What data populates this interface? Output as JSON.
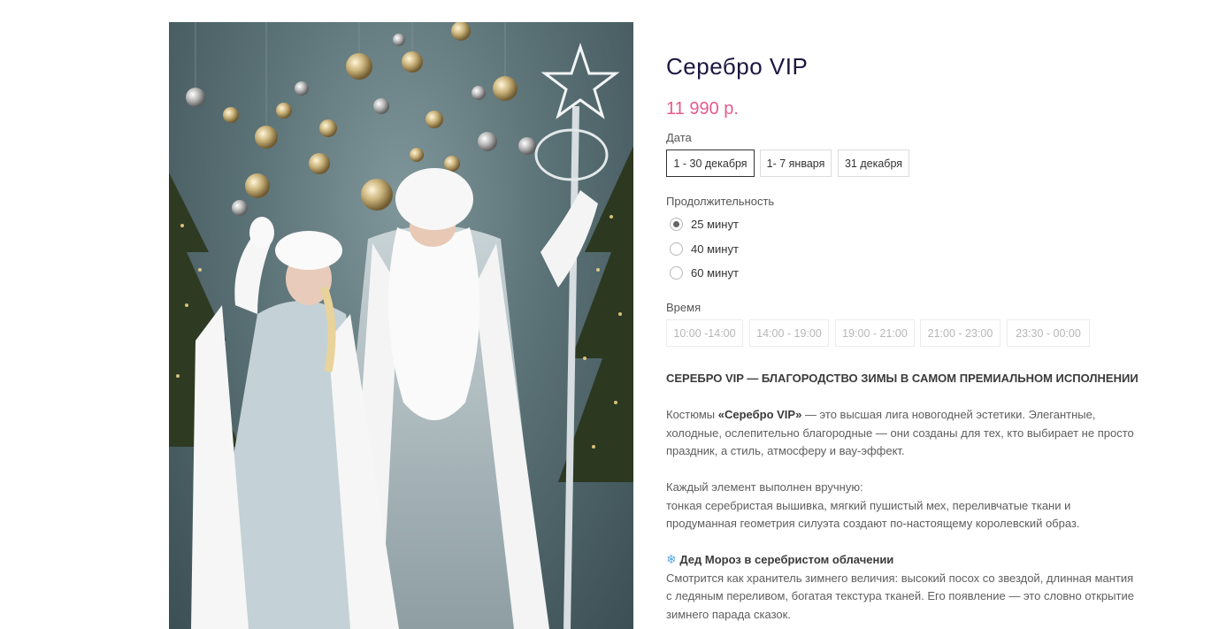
{
  "product": {
    "title": "Серебро VIP",
    "price": "11 990 р.",
    "image_alt": "Дед Мороз и Снегурочка в серебристых костюмах"
  },
  "date_section": {
    "label": "Дата",
    "options": [
      "1 - 30 декабря",
      "1- 7 января",
      "31 декабря"
    ],
    "selected": "1 - 30 декабря"
  },
  "duration_section": {
    "label": "Продолжительность",
    "options": [
      "25 минут",
      "40 минут",
      "60 минут"
    ],
    "selected": "25 минут"
  },
  "time_section": {
    "label": "Время",
    "options": [
      "10:00 -14:00",
      "14:00 - 19:00",
      "19:00 - 21:00",
      "21:00 - 23:00",
      "23:30 - 00:00"
    ]
  },
  "description": {
    "heading": "СЕРЕБРО VIP — БЛАГОРОДСТВО ЗИМЫ В САМОМ ПРЕМИАЛЬНОМ ИСПОЛНЕНИИ",
    "p1_prefix": "Костюмы ",
    "p1_bold": "«Серебро VIP»",
    "p1_rest": " — это высшая лига новогодней эстетики. Элегантные, холодные, ослепительно благородные — они созданы для тех, кто выбирает не просто праздник, а стиль, атмосферу и вау-эффект.",
    "p2_line1": "Каждый элемент выполнен вручную:",
    "p2_line2": "тонкая серебристая вышивка, мягкий пушистый мех, переливчатые ткани и продуманная геометрия силуэта создают по-настоящему королевский образ.",
    "p3_icon": "❄",
    "p3_heading": "Дед Мороз в серебристом облачении",
    "p3_text": "Смотрится как хранитель зимнего величия: высокий посох со звездой, длинная мантия с ледяным переливом, богатая текстура тканей. Его появление — это словно открытие зимнего парада сказок."
  },
  "colors": {
    "accent_price": "#e75a8d",
    "title": "#1d1740",
    "snowflake": "#58a9e3"
  }
}
